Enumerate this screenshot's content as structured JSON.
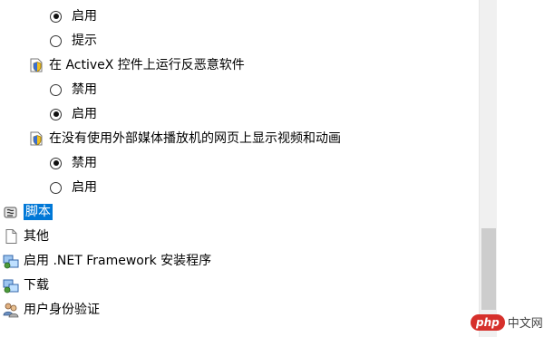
{
  "tree": {
    "group1_options": [
      {
        "label": "启用",
        "checked": true
      },
      {
        "label": "提示",
        "checked": false
      }
    ],
    "activex_setting": {
      "label": "在 ActiveX 控件上运行反恶意软件",
      "icon": "security-setting-icon",
      "options": [
        {
          "label": "禁用",
          "checked": false
        },
        {
          "label": "启用",
          "checked": true
        }
      ]
    },
    "media_setting": {
      "label": "在没有使用外部媒体播放机的网页上显示视频和动画",
      "icon": "security-setting-icon",
      "options": [
        {
          "label": "禁用",
          "checked": true
        },
        {
          "label": "启用",
          "checked": false
        }
      ]
    },
    "categories": [
      {
        "label": "脚本",
        "icon": "script-icon",
        "selected": true
      },
      {
        "label": "其他",
        "icon": "document-icon",
        "selected": false
      },
      {
        "label": "启用 .NET Framework 安装程序",
        "icon": "net-framework-icon",
        "selected": false
      },
      {
        "label": "下载",
        "icon": "download-icon",
        "selected": false
      },
      {
        "label": "用户身份验证",
        "icon": "users-icon",
        "selected": false
      }
    ]
  },
  "watermark": {
    "logo": "php",
    "text": "中文网"
  },
  "colors": {
    "selection": "#0078d7",
    "scrollbar_thumb": "#cdcdcd",
    "watermark": "#d6302b"
  }
}
